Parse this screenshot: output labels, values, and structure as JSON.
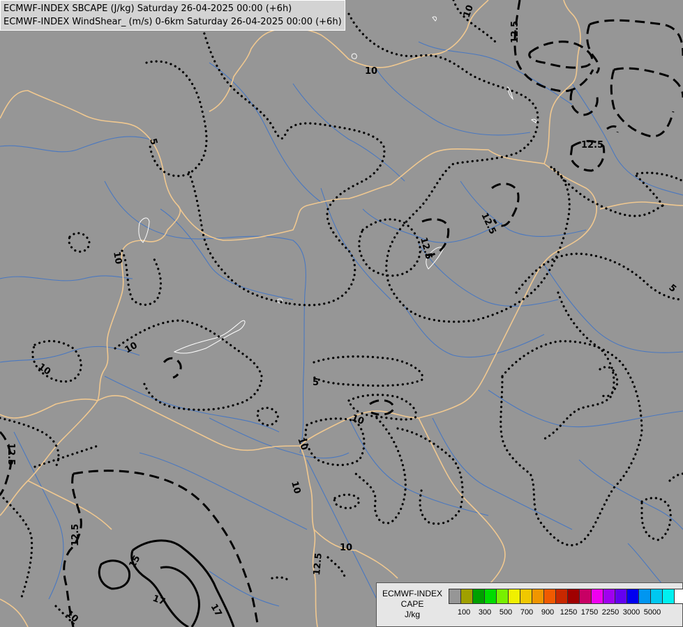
{
  "header": {
    "line1": "ECMWF-INDEX SBCAPE (J/kg) Saturday 26-04-2025 00:00 (+6h)",
    "line2": "ECMWF-INDEX WindShear_ (m/s) 0-6km Saturday 26-04-2025 00:00 (+6h)"
  },
  "map": {
    "background_color": "#969696",
    "border_color": "#f0c890",
    "river_color": "#4a78c0",
    "lake_outline_color": "#ffffff",
    "contour_labels": [
      "10",
      "12.5",
      "10",
      "12.5",
      "5",
      "12.5",
      "12.5",
      "12.5",
      "10",
      "10",
      "10",
      "5",
      "5",
      "10",
      "10",
      "10",
      "12.5",
      "12.5",
      "15",
      "17",
      "17",
      "10",
      "10"
    ]
  },
  "legend": {
    "title_lines": [
      "ECMWF-INDEX",
      "CAPE",
      "J/kg"
    ],
    "colors": [
      "#969696",
      "#a0a000",
      "#00a000",
      "#00dc00",
      "#78f000",
      "#f0f000",
      "#f0c800",
      "#f09600",
      "#f05a00",
      "#c82800",
      "#a00000",
      "#c80064",
      "#f000f0",
      "#a000f0",
      "#6400f0",
      "#0000f0",
      "#0096f0",
      "#00c8f0",
      "#00f0f0",
      "#ffffff"
    ],
    "tick_labels": [
      "100",
      "300",
      "500",
      "700",
      "900",
      "1250",
      "1750",
      "2250",
      "3000",
      "5000"
    ]
  }
}
